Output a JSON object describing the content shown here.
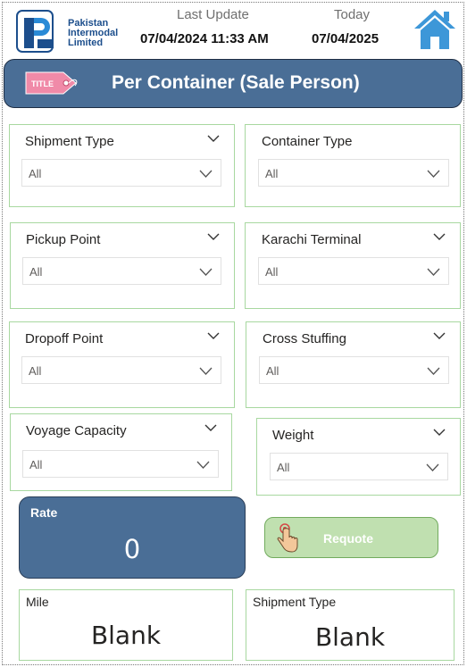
{
  "header": {
    "logo_lines": [
      "Pakistan",
      "Intermodal",
      "Limited"
    ],
    "last_update_label": "Last Update",
    "last_update_value": "07/04/2024 11:33 AM",
    "today_label": "Today",
    "today_value": "07/04/2025",
    "home_icon": "home-icon"
  },
  "title_bar": {
    "tag_text": "TITLE",
    "title": "Per Container (Sale Person)"
  },
  "slicers": [
    {
      "label": "Shipment Type",
      "value": "All"
    },
    {
      "label": "Container Type",
      "value": "All"
    },
    {
      "label": "Pickup Point",
      "value": "All"
    },
    {
      "label": "Karachi Terminal",
      "value": "All"
    },
    {
      "label": "Dropoff Point",
      "value": "All"
    },
    {
      "label": "Cross Stuffing",
      "value": "All"
    },
    {
      "label": "Voyage Capacity",
      "value": "All"
    },
    {
      "label": "Weight",
      "value": "All"
    }
  ],
  "rate_card": {
    "label": "Rate",
    "value": "0"
  },
  "requote_button": {
    "label": "Requote",
    "icon": "hand-pointer-icon"
  },
  "cards": [
    {
      "label": "Mile",
      "value": "Blank"
    },
    {
      "label": "Shipment Type",
      "value": "Blank"
    }
  ],
  "colors": {
    "accent_blue": "#4a6e96",
    "slicer_border": "#a8d8a0",
    "requote_fill": "#c0e0b0",
    "home_icon_blue": "#3d97d8",
    "logo_blue": "#1c4e8c"
  }
}
